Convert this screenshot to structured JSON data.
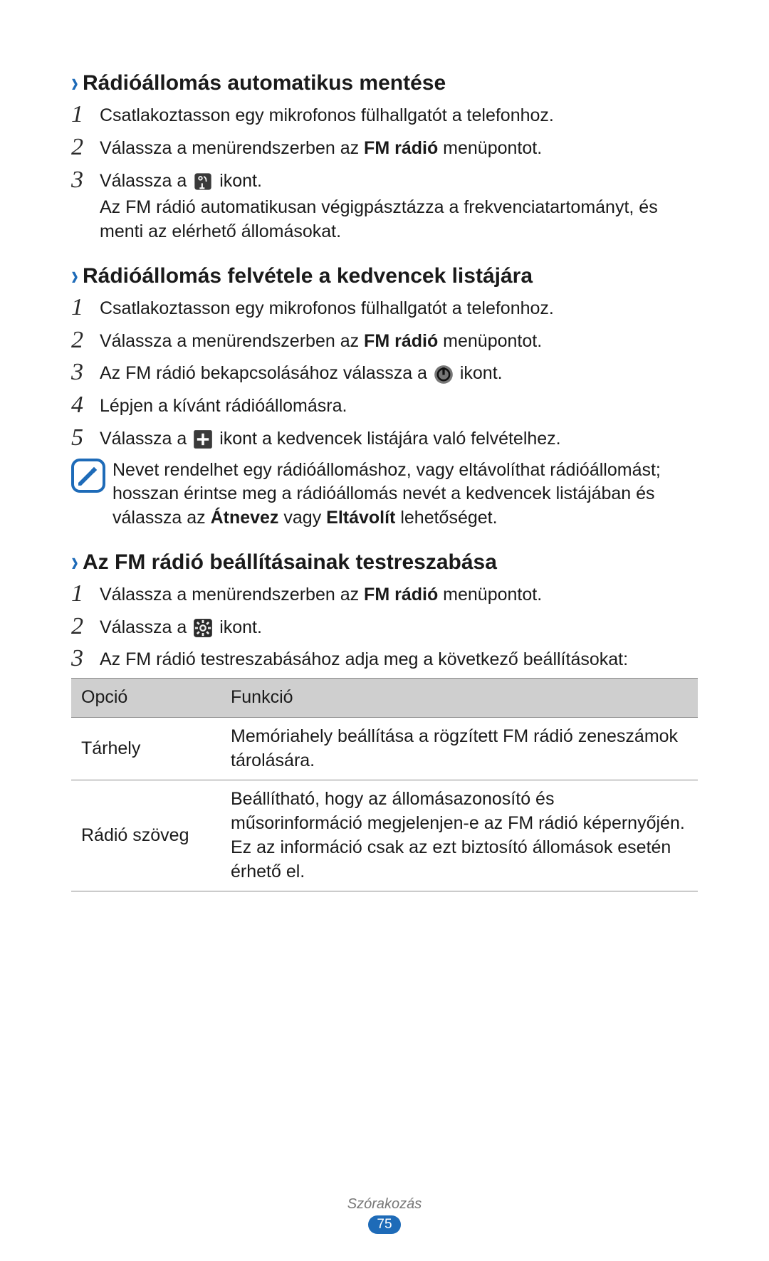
{
  "sections": [
    {
      "heading": "Rádióállomás automatikus mentése",
      "steps": [
        {
          "num": "1",
          "body_pre": "Csatlakoztasson egy mikrofonos fülhallgatót a telefonhoz."
        },
        {
          "num": "2",
          "body_pre": "Válassza a menürendszerben az ",
          "bold": "FM rádió",
          "body_post": " menüpontot."
        },
        {
          "num": "3",
          "body_pre": "Válassza a ",
          "icon": "scan",
          "body_post": " ikont.",
          "sub": "Az FM rádió automatikusan végigpásztázza a frekvenciatartományt, és menti az elérhető állomásokat."
        }
      ]
    },
    {
      "heading": "Rádióállomás felvétele a kedvencek listájára",
      "steps": [
        {
          "num": "1",
          "body_pre": "Csatlakoztasson egy mikrofonos fülhallgatót a telefonhoz."
        },
        {
          "num": "2",
          "body_pre": "Válassza a menürendszerben az ",
          "bold": "FM rádió",
          "body_post": " menüpontot."
        },
        {
          "num": "3",
          "body_pre": "Az FM rádió bekapcsolásához válassza a ",
          "icon": "power",
          "body_post": " ikont."
        },
        {
          "num": "4",
          "body_pre": "Lépjen a kívánt rádióállomásra."
        },
        {
          "num": "5",
          "body_pre": "Válassza a ",
          "icon": "plus",
          "body_post": " ikont a kedvencek listájára való felvételhez."
        }
      ],
      "note": {
        "pre": "Nevet rendelhet egy rádióállomáshoz, vagy eltávolíthat rádióállomást; hosszan érintse meg a rádióállomás nevét a kedvencek listájában és válassza az ",
        "bold1": "Átnevez",
        "mid": " vagy ",
        "bold2": "Eltávolít",
        "post": " lehetőséget."
      }
    },
    {
      "heading": "Az FM rádió beállításainak testreszabása",
      "steps": [
        {
          "num": "1",
          "body_pre": "Válassza a menürendszerben az ",
          "bold": "FM rádió",
          "body_post": " menüpontot."
        },
        {
          "num": "2",
          "body_pre": "Válassza a ",
          "icon": "settings",
          "body_post": " ikont."
        },
        {
          "num": "3",
          "body_pre": "Az FM rádió testreszabásához adja meg a következő beállításokat:"
        }
      ],
      "table": {
        "header_opt": "Opció",
        "header_func": "Funkció",
        "rows": [
          {
            "opt": "Tárhely",
            "func": "Memóriahely beállítása a rögzített FM rádió zeneszámok tárolására."
          },
          {
            "opt": "Rádió szöveg",
            "func": "Beállítható, hogy az állomásazonosító és műsorinformáció megjelenjen-e az FM rádió képernyőjén. Ez az információ csak az ezt biztosító állomások esetén érhető el."
          }
        ]
      }
    }
  ],
  "footer": {
    "section": "Szórakozás",
    "page": "75"
  }
}
